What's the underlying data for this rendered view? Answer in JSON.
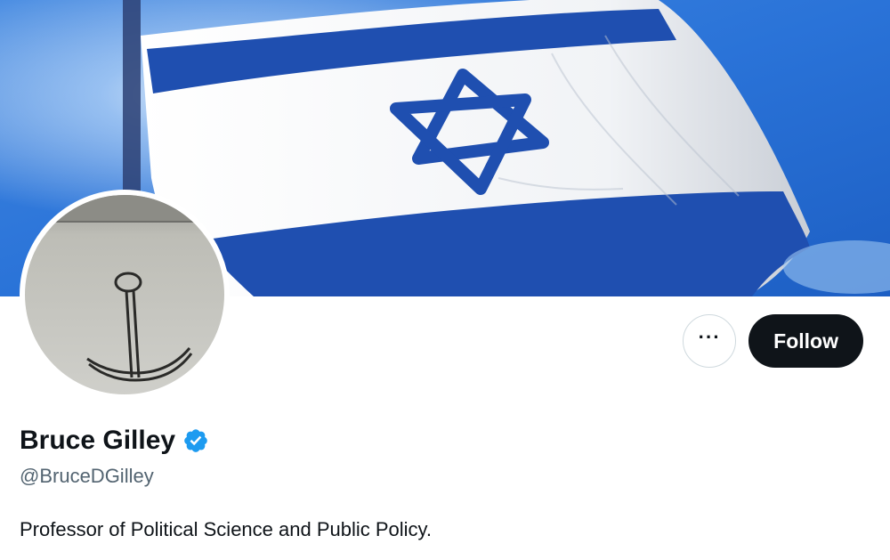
{
  "profile": {
    "display_name": "Bruce Gilley",
    "handle": "@BruceDGilley",
    "bio": "Professor of Political Science and Public Policy.",
    "verified": true
  },
  "actions": {
    "more_label": "···",
    "follow_label": "Follow"
  },
  "icons": {
    "more": "more-horizontal-icon",
    "verified": "verified-badge-icon"
  },
  "colors": {
    "follow_bg": "#0f1419",
    "verified_blue": "#1d9bf0",
    "handle_gray": "#536471",
    "flag_blue": "#1f4fb0"
  }
}
